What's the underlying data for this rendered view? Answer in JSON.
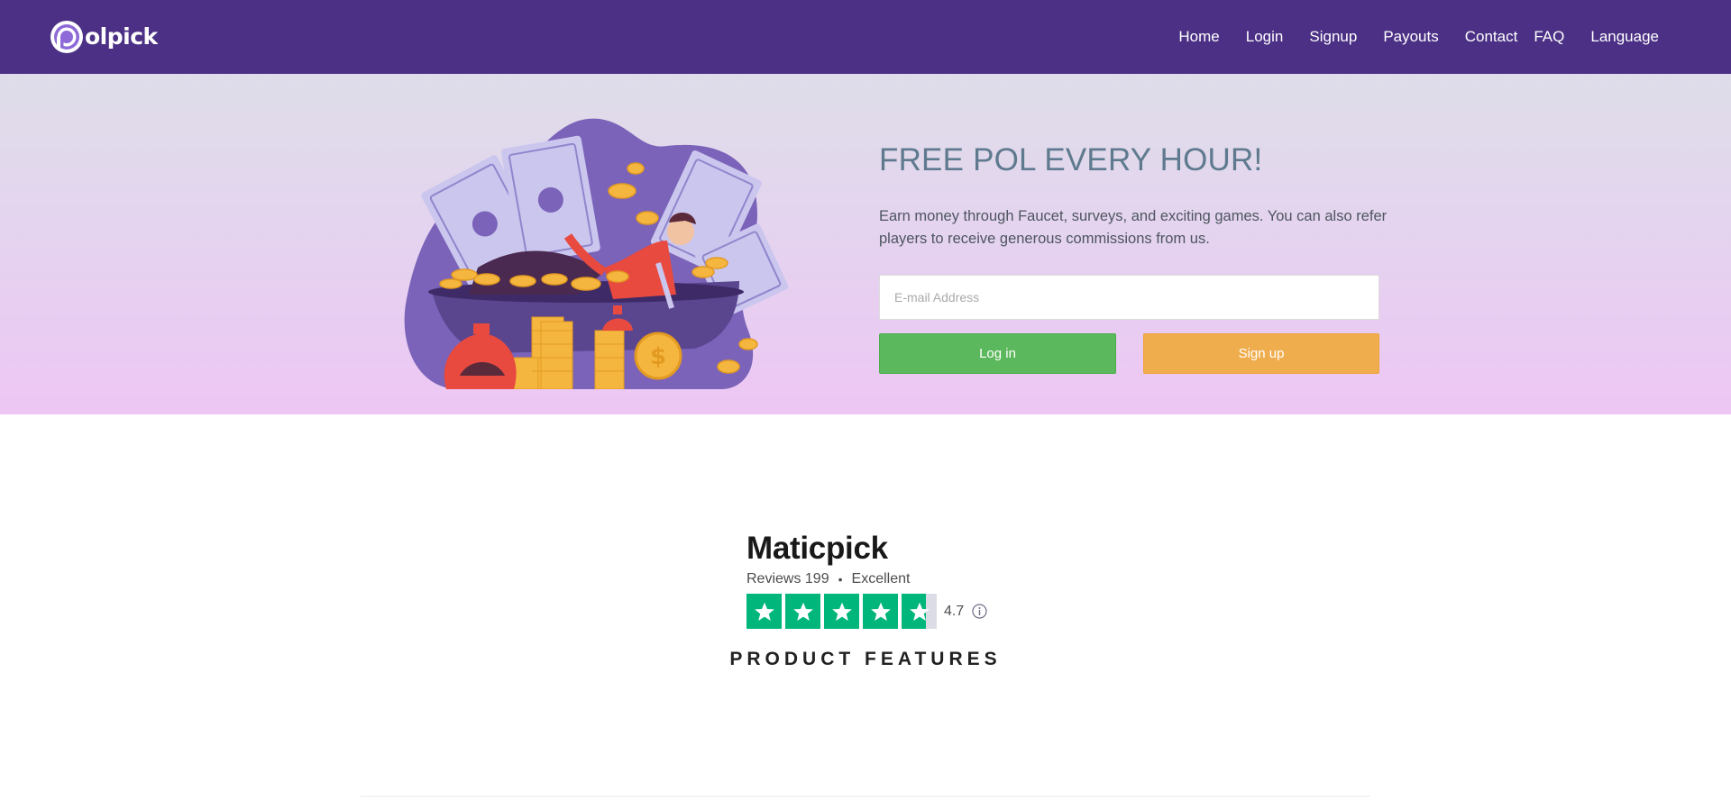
{
  "navbar": {
    "logo_text": "olpick",
    "logo_alt": "Polpick",
    "links": [
      {
        "label": "Home"
      },
      {
        "label": "Login"
      },
      {
        "label": "Signup"
      },
      {
        "label": "Payouts"
      },
      {
        "label": "Contact"
      },
      {
        "label": "FAQ"
      },
      {
        "label": "Language"
      }
    ]
  },
  "hero": {
    "title": "FREE POL EVERY HOUR!",
    "description": "Earn money through Faucet, surveys, and exciting games. You can also refer players to receive generous commissions from us.",
    "email_placeholder": "E-mail Address",
    "email_value": "",
    "login_label": "Log in",
    "signup_label": "Sign up"
  },
  "reviews": {
    "name": "Maticpick",
    "reviews_label": "Reviews 199",
    "separator": "•",
    "rating_label": "Excellent",
    "score": "4.7",
    "star_rating": 4.7,
    "star_color": "#00b67a"
  },
  "features": {
    "title": "PRODUCT FEATURES"
  },
  "colors": {
    "navbar": "#4b3085",
    "title": "#5f7a8e",
    "login_button": "#5cb85c",
    "signup_button": "#f0ad4e"
  }
}
